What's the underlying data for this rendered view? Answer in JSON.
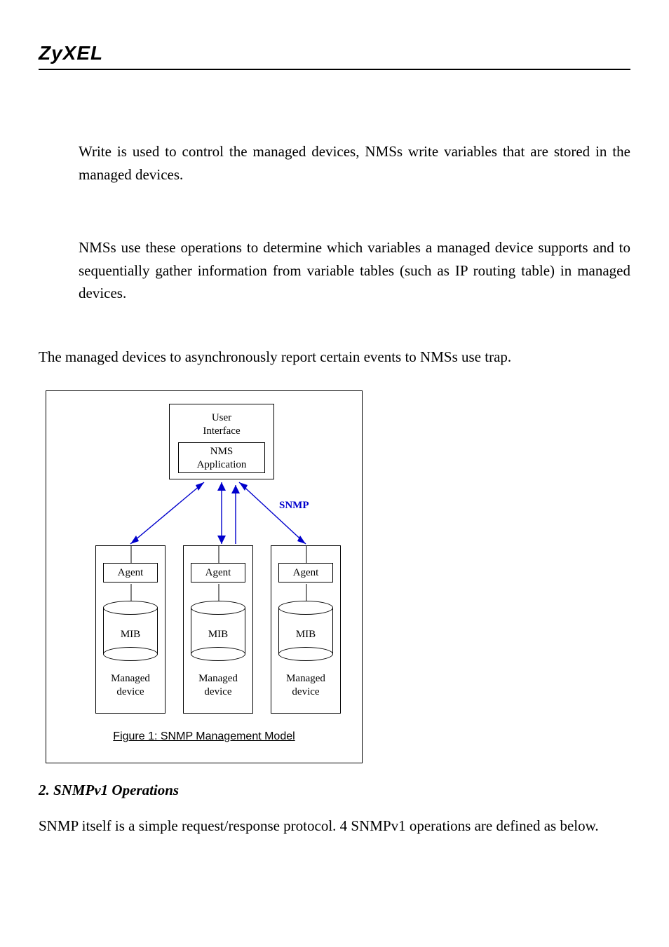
{
  "brand": "ZyXEL",
  "paragraphs": {
    "p1": "Write is used to control the managed devices, NMSs write variables that are stored in the managed devices.",
    "p2": "NMSs use these operations to determine which variables a managed device supports and to sequentially gather information from variable tables (such as IP routing table) in managed devices.",
    "p3": "The managed devices to asynchronously report certain events to NMSs use trap."
  },
  "diagram": {
    "user_interface": "User\nInterface",
    "nms_app": "NMS\nApplication",
    "snmp": "SNMP",
    "agent": "Agent",
    "mib": "MIB",
    "managed_device": "Managed\ndevice",
    "caption": "Figure 1: SNMP Management Model"
  },
  "section2_title": "2. SNMPv1 Operations",
  "section2_body": "SNMP itself is a simple request/response protocol. 4 SNMPv1 operations are defined as below."
}
